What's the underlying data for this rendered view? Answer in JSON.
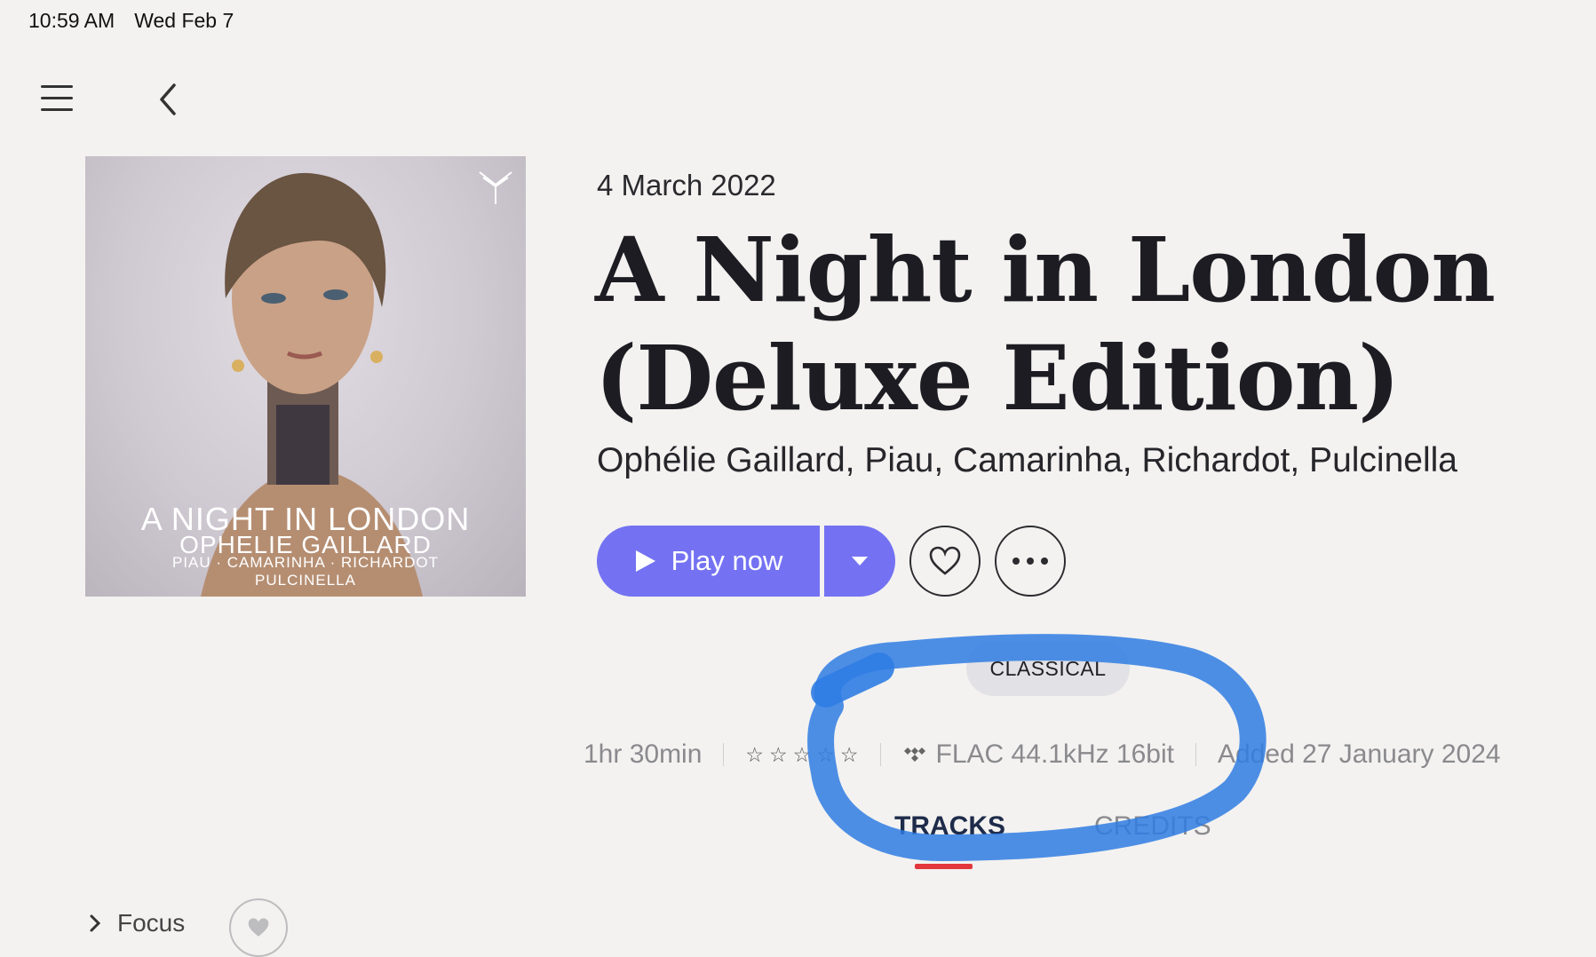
{
  "status_bar": {
    "time": "10:59 AM",
    "date": "Wed Feb 7"
  },
  "nav": {
    "menu_icon": "hamburger-menu-icon",
    "back_icon": "chevron-left-icon"
  },
  "cover": {
    "title": "A NIGHT IN LONDON",
    "artist": "OPHELIE GAILLARD",
    "performers": "PIAU · CAMARINHA · RICHARDOT",
    "ensemble": "PULCINELLA",
    "logo_icon": "label-logo-icon"
  },
  "album": {
    "release_date": "4 March 2022",
    "title_line1": "A Night in London",
    "title_line2": "(Deluxe Edition)",
    "artists": "Ophélie Gaillard, Piau, Camarinha, Richardot, Pulcinella"
  },
  "actions": {
    "play_label": "Play now",
    "play_icon": "play-icon",
    "dropdown_icon": "caret-down-icon",
    "favorite_icon": "heart-icon",
    "more_icon": "more-icon"
  },
  "genre": "CLASSICAL",
  "info": {
    "duration": "1hr 30min",
    "rating": 0,
    "rating_max": 5,
    "quality": "FLAC 44.1kHz 16bit",
    "quality_icon": "tidal-icon",
    "added": "Added 27 January 2024"
  },
  "tabs": [
    {
      "label": "TRACKS",
      "active": true
    },
    {
      "label": "CREDITS",
      "active": false
    }
  ],
  "focus": {
    "label": "Focus"
  },
  "colors": {
    "accent": "#7472f2",
    "tab_indicator": "#e2373c",
    "annotation": "#2f7ce3",
    "background": "#f3f2f0"
  }
}
